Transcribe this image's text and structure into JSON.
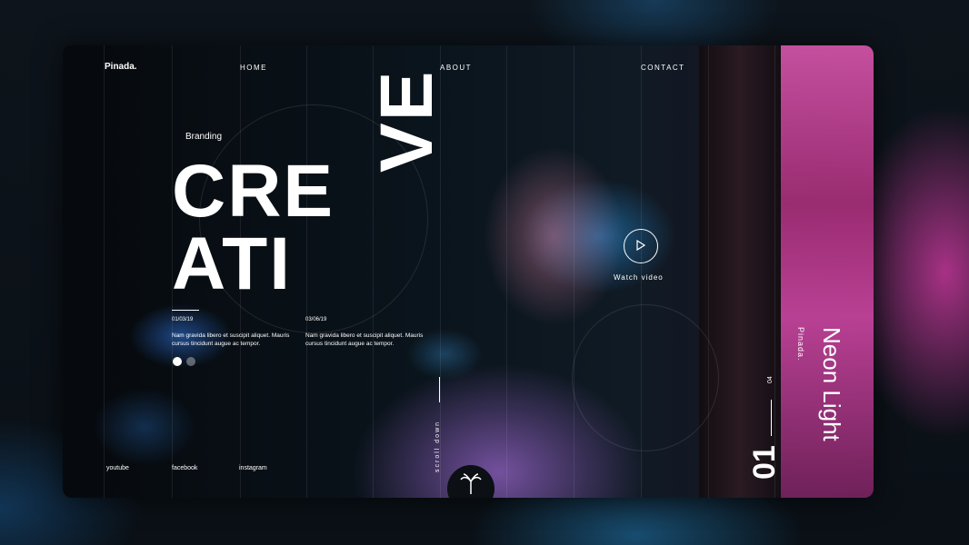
{
  "brand": "Pinada.",
  "nav": [
    "HOME",
    "ABOUT",
    "CONTACT"
  ],
  "hero": {
    "eyebrow": "Branding",
    "line1": "CRE",
    "line2": "ATI",
    "line3": "VE"
  },
  "posts": [
    {
      "date": "01/03/19",
      "text": "Nam gravida libero et suscipit aliquet. Mauris cursus tincidunt augue ac tempor."
    },
    {
      "date": "03/06/19",
      "text": "Nam gravida libero et suscipit aliquet. Mauris cursus tincidunt augue ac tempor."
    }
  ],
  "watch": "Watch video",
  "scroll": "scroll down",
  "side": {
    "brand": "Pinada.",
    "title": "Neon Light",
    "current": "01",
    "total": "04"
  },
  "social": [
    "youtube",
    "facebook",
    "instagram"
  ],
  "colors": {
    "accent": "#e25ab5",
    "bg": "#0b1218"
  },
  "icons": {
    "play": "play-icon",
    "palm": "palm-tree-icon"
  }
}
